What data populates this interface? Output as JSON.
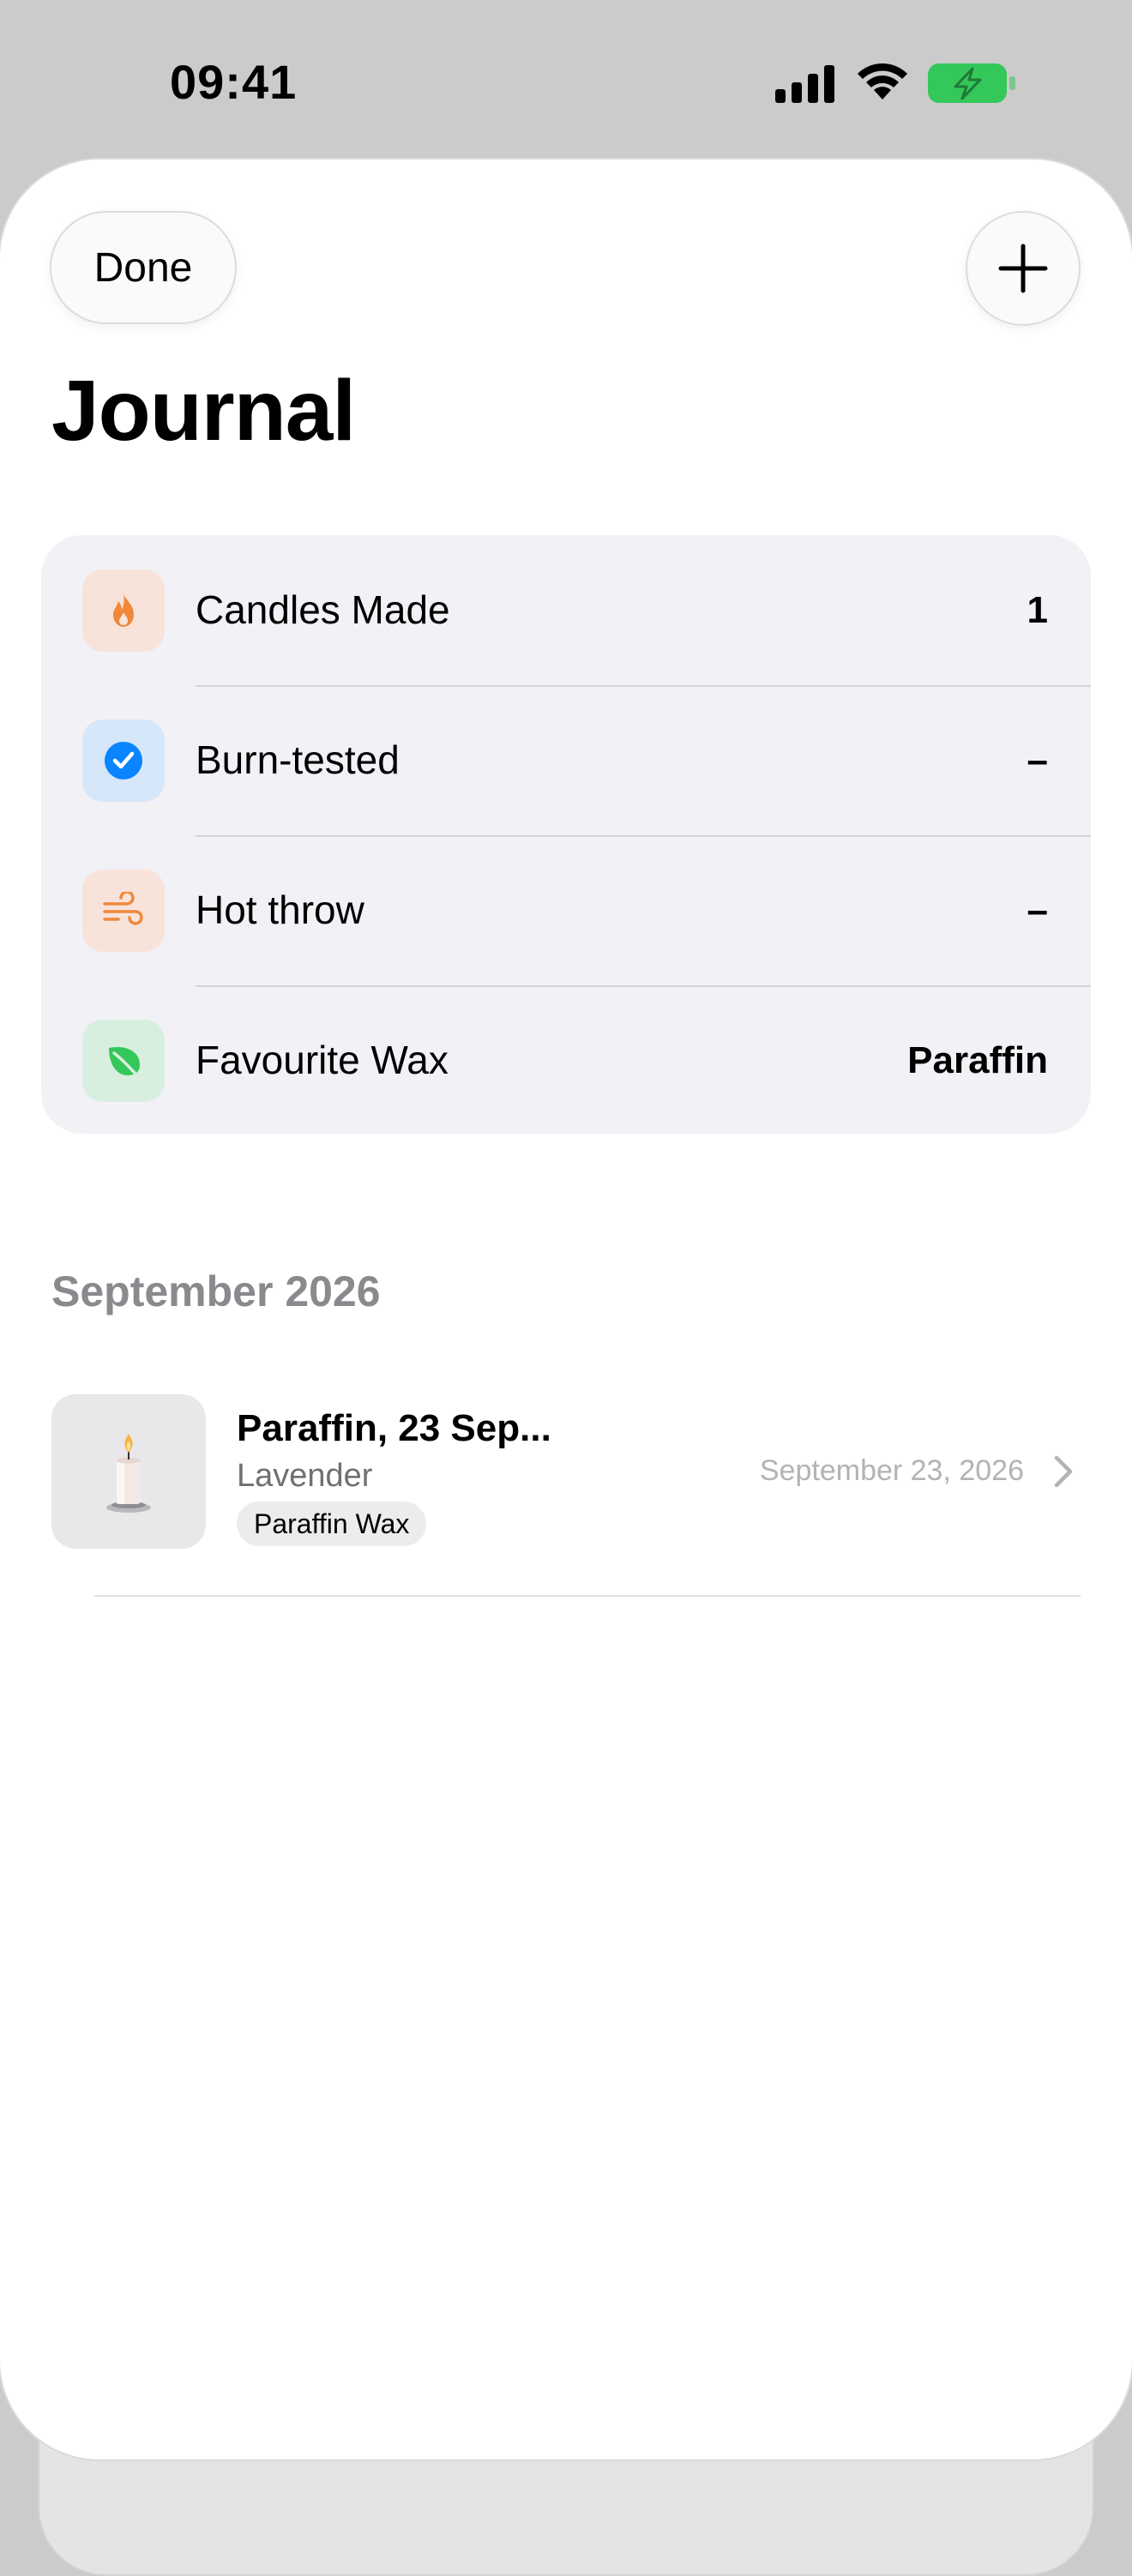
{
  "status_bar": {
    "time": "09:41",
    "icons": [
      "cellular-signal-icon",
      "wifi-icon",
      "battery-charging-icon"
    ],
    "battery_color": "#34c759"
  },
  "header": {
    "done_label": "Done",
    "add_icon": "plus-icon",
    "title": "Journal"
  },
  "stats": [
    {
      "icon": "flame-icon",
      "label": "Candles Made",
      "value": "1",
      "tile_color": "#f8e3db",
      "icon_color": "#f0883a"
    },
    {
      "icon": "checkmark-circle-icon",
      "label": "Burn-tested",
      "value": "–",
      "tile_color": "#d7e7fa",
      "icon_color": "#0a84ff"
    },
    {
      "icon": "wind-icon",
      "label": "Hot throw",
      "value": "–",
      "tile_color": "#f8e3db",
      "icon_color": "#f0883a"
    },
    {
      "icon": "leaf-icon",
      "label": "Favourite Wax",
      "value": "Paraffin",
      "tile_color": "#d8efe0",
      "icon_color": "#34c759"
    }
  ],
  "section": {
    "title": "September 2026",
    "entries": [
      {
        "thumb_icon": "candle-icon",
        "title": "Paraffin, 23 Sep...",
        "subtitle": "Lavender",
        "tag": "Paraffin Wax",
        "date": "September 23, 2026",
        "chevron_icon": "chevron-right-icon"
      }
    ]
  }
}
